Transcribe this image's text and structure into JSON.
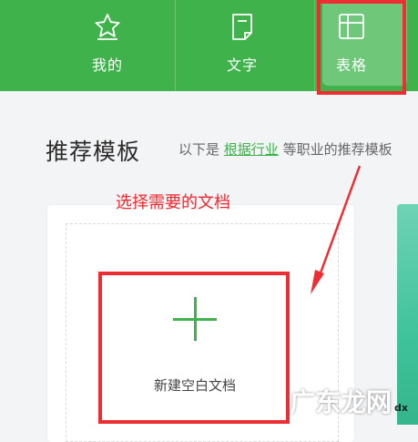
{
  "tabs": [
    {
      "label": "我的",
      "icon": "star-icon"
    },
    {
      "label": "文字",
      "icon": "document-icon"
    },
    {
      "label": "表格",
      "icon": "table-icon",
      "active": true
    }
  ],
  "section": {
    "title": "推荐模板",
    "desc_prefix": "以下是",
    "desc_link": "根据行业",
    "desc_suffix": "等职业的推荐模板"
  },
  "annotation": {
    "instruction": "选择需要的文档"
  },
  "new_doc": {
    "label": "新建空白文档"
  },
  "watermark": {
    "text": "广东龙网",
    "suffix": "dx"
  },
  "colors": {
    "brand_green": "#3fb24b",
    "annotation_red": "#ee2d33"
  }
}
